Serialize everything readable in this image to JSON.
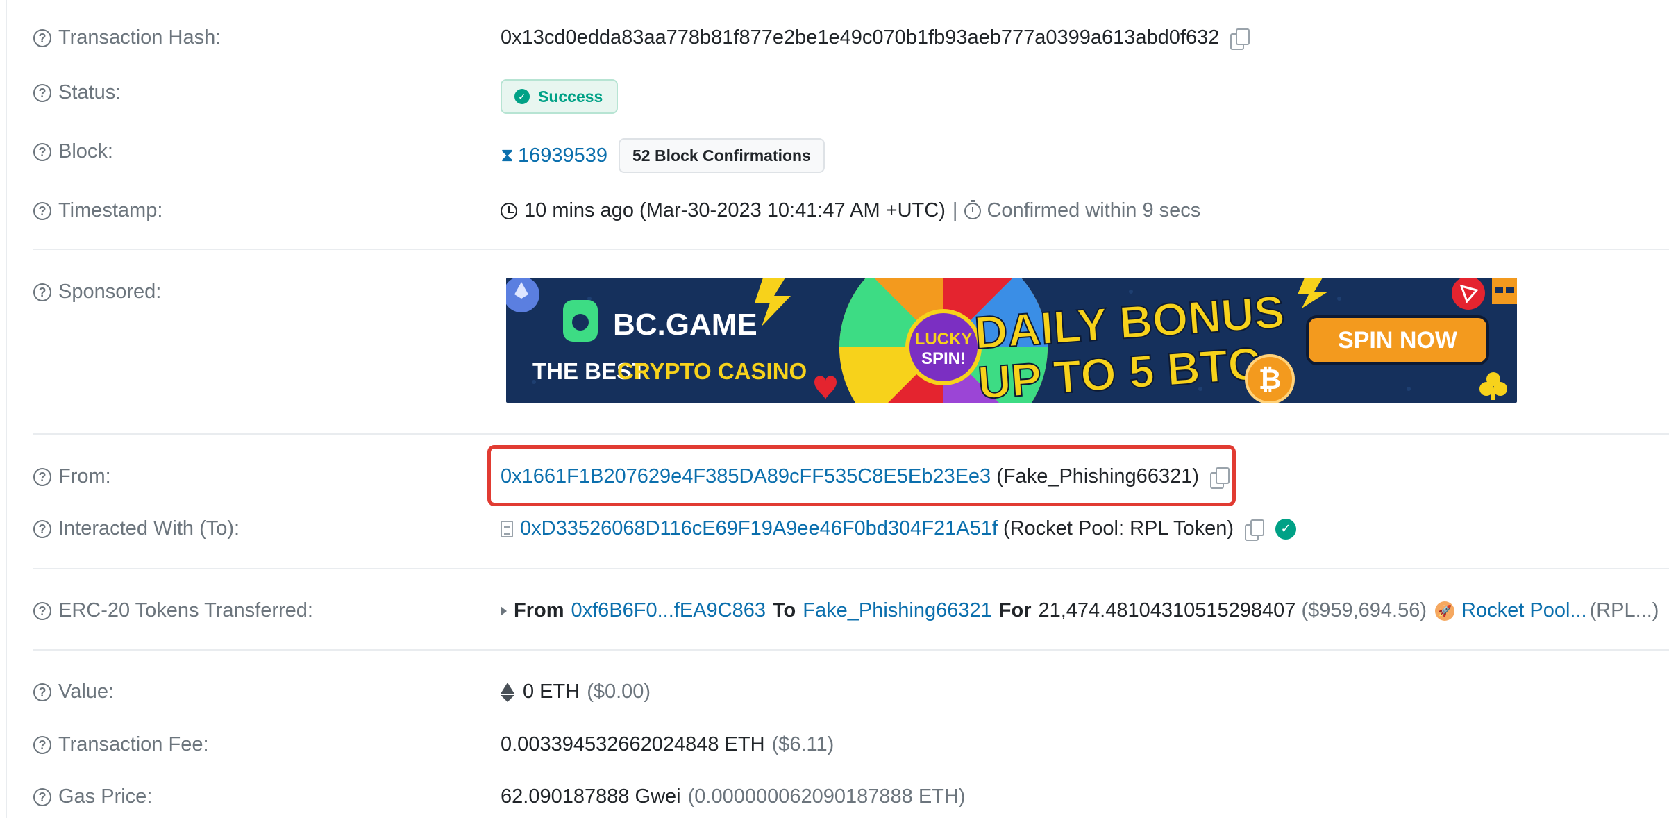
{
  "rows": {
    "tx_hash": {
      "label": "Transaction Hash:",
      "value": "0x13cd0edda83aa778b81f877e2be1e49c070b1fb93aeb777a0399a613abd0f632"
    },
    "status": {
      "label": "Status:",
      "value": "Success"
    },
    "block": {
      "label": "Block:",
      "number": "16939539",
      "confirmations": "52 Block Confirmations"
    },
    "timestamp": {
      "label": "Timestamp:",
      "value": "10 mins ago (Mar-30-2023 10:41:47 AM +UTC)",
      "divider": "|",
      "confirmed": "Confirmed within 9 secs"
    },
    "sponsored": {
      "label": "Sponsored:"
    },
    "from": {
      "label": "From:",
      "address": "0x1661F1B207629e4F385DA89cFF535C8E5Eb23Ee3",
      "tag": "(Fake_Phishing66321)"
    },
    "to": {
      "label": "Interacted With (To):",
      "address": "0xD33526068D116cE69F19A9ee46F0bd304F21A51f",
      "tag": "(Rocket Pool: RPL Token)"
    },
    "erc20": {
      "label": "ERC-20 Tokens Transferred:",
      "from_word": "From",
      "from_addr": "0xf6B6F0...fEA9C863",
      "to_word": "To",
      "to_addr": "Fake_Phishing66321",
      "for_word": "For",
      "amount": "21,474.48104310515298407",
      "usd": "($959,694.56)",
      "token_name": "Rocket Pool...",
      "token_symbol": "(RPL...)"
    },
    "value": {
      "label": "Value:",
      "eth": "0 ETH",
      "usd": "($0.00)"
    },
    "fee": {
      "label": "Transaction Fee:",
      "eth": "0.003394532662024848 ETH",
      "usd": "($6.11)"
    },
    "gas": {
      "label": "Gas Price:",
      "gwei": "62.090187888 Gwei",
      "eth": "(0.000000062090187888 ETH)"
    }
  },
  "banner": {
    "brand": "BC.GAME",
    "tagline_a": "THE BEST",
    "tagline_b": "CRYPTO CASINO",
    "wheel_a": "LUCKY",
    "wheel_b": "SPIN!",
    "headline_1": "DAILY BONUS",
    "headline_2": "UP TO 5 BTC",
    "cta": "SPIN NOW",
    "colors": {
      "bg": "#15305c",
      "yellow": "#f7d21b",
      "orange": "#f39a1e",
      "green": "#3ddc84"
    }
  },
  "icons": {
    "help": "question-circle-icon",
    "copy": "copy-icon",
    "success": "check-circle-icon",
    "block": "hourglass-icon",
    "clock": "clock-icon",
    "timer": "stopwatch-icon",
    "contract": "document-icon",
    "verified": "verified-check-icon",
    "expand": "caret-right-icon",
    "token": "rocket-pool-icon",
    "eth": "ethereum-icon"
  },
  "colors": {
    "link": "#0b6fad",
    "success": "#00a186",
    "highlight": "#e13b32",
    "muted": "#6c757d"
  }
}
